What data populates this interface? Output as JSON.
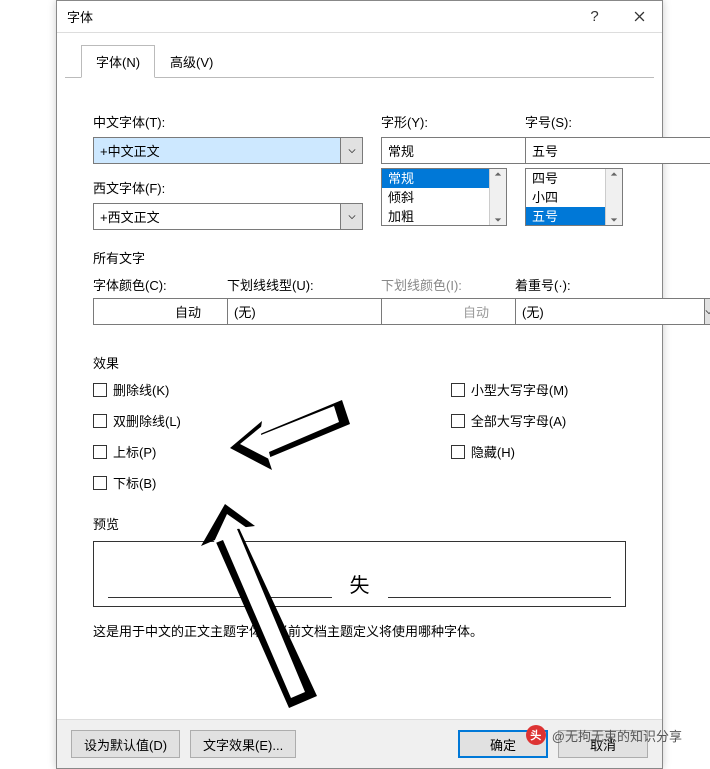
{
  "title": "字体",
  "tabs": {
    "font": "字体(N)",
    "advanced": "高级(V)"
  },
  "fields": {
    "cn_font_label": "中文字体(T):",
    "cn_font_value": "+中文正文",
    "west_font_label": "西文字体(F):",
    "west_font_value": "+西文正文",
    "style_label": "字形(Y):",
    "style_value": "常规",
    "style_options": [
      "常规",
      "倾斜",
      "加粗"
    ],
    "size_label": "字号(S):",
    "size_value": "五号",
    "size_options": [
      "四号",
      "小四",
      "五号"
    ]
  },
  "all_text_section": "所有文字",
  "controls": {
    "font_color_label": "字体颜色(C):",
    "font_color_value": "自动",
    "underline_style_label": "下划线线型(U):",
    "underline_style_value": "(无)",
    "underline_color_label": "下划线颜色(I):",
    "underline_color_value": "自动",
    "emphasis_label": "着重号(·):",
    "emphasis_value": "(无)"
  },
  "effects_section": "效果",
  "effects": {
    "strike": "删除线(K)",
    "dblstrike": "双删除线(L)",
    "superscript": "上标(P)",
    "subscript": "下标(B)",
    "smallcaps": "小型大写字母(M)",
    "allcaps": "全部大写字母(A)",
    "hidden": "隐藏(H)"
  },
  "preview_section": "预览",
  "preview_text": "失",
  "description": "这是用于中文的正文主题字体。当前文档主题定义将使用哪种字体。",
  "buttons": {
    "setdefault": "设为默认值(D)",
    "texteffects": "文字效果(E)...",
    "ok": "确定",
    "cancel": "取消"
  },
  "watermark": "@无拘无束的知识分享"
}
